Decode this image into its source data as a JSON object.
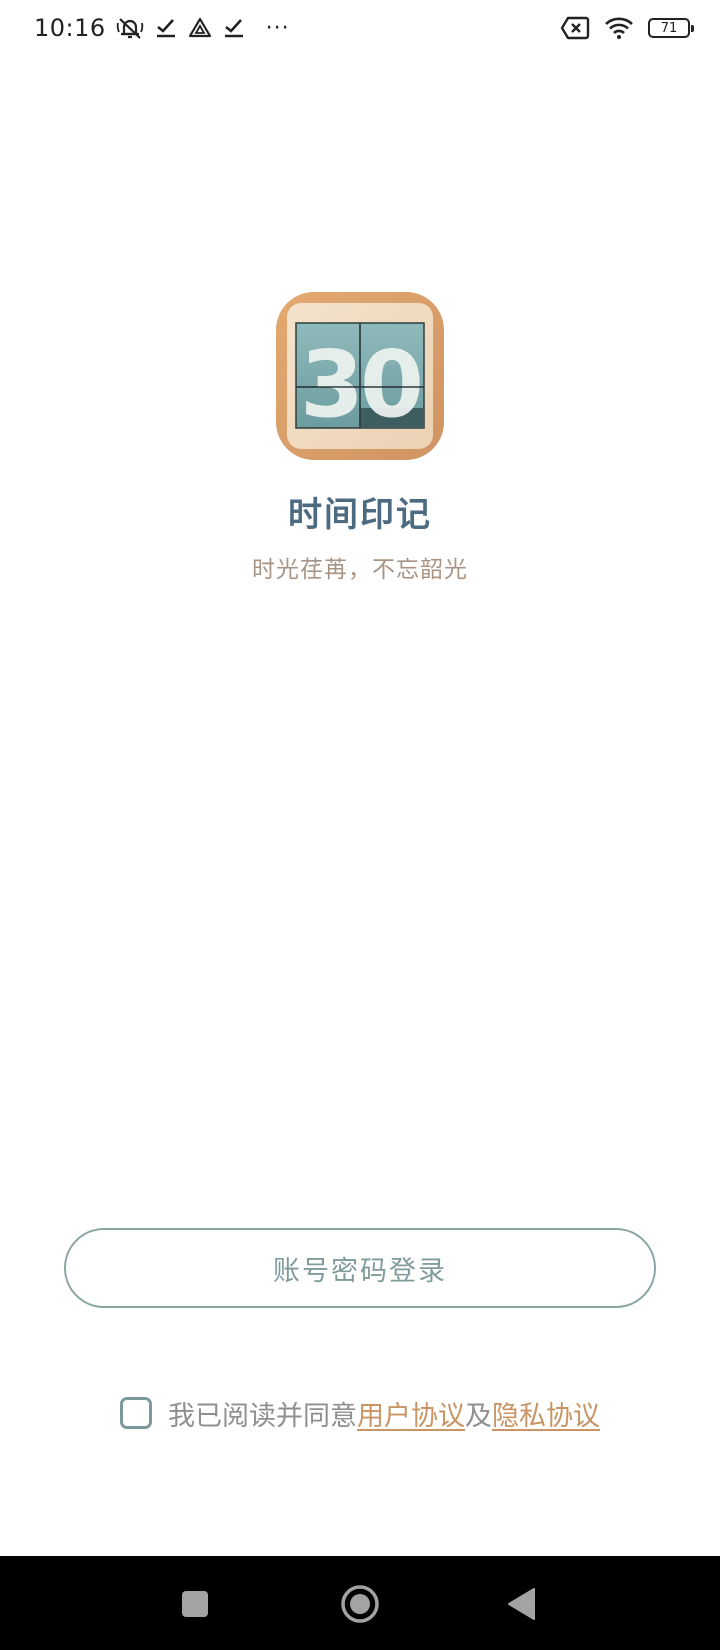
{
  "status_bar": {
    "time": "10:16",
    "icons_left": [
      "mute-icon",
      "check-download-icon",
      "drive-icon",
      "check-download-icon",
      "more-dots-icon"
    ],
    "more_label": "···",
    "icons_right": [
      "sim-off-icon",
      "wifi-icon",
      "battery-icon"
    ],
    "battery_level": "71"
  },
  "app": {
    "name": "时间印记",
    "slogan": "时光荏苒，不忘韶光",
    "logo_digits": "30",
    "logo_icon": "flip-clock-icon"
  },
  "login": {
    "button_label": "账号密码登录"
  },
  "agreement": {
    "prefix": "我已阅读并同意",
    "user_agreement": "用户协议",
    "connector": "及",
    "privacy_agreement": "隐私协议",
    "checked": false
  },
  "nav_bar": {
    "buttons": [
      "square-recents-icon",
      "circle-home-icon",
      "triangle-back-icon"
    ]
  },
  "colors": {
    "title": "#4d6b80",
    "slogan": "#a89484",
    "button_border": "#8aa5a3",
    "button_text": "#7f9c9b",
    "link": "#c99564",
    "muted_text": "#8f8f8f",
    "logo_frame": "#d9a06c",
    "logo_panel": "#79a8ab"
  }
}
